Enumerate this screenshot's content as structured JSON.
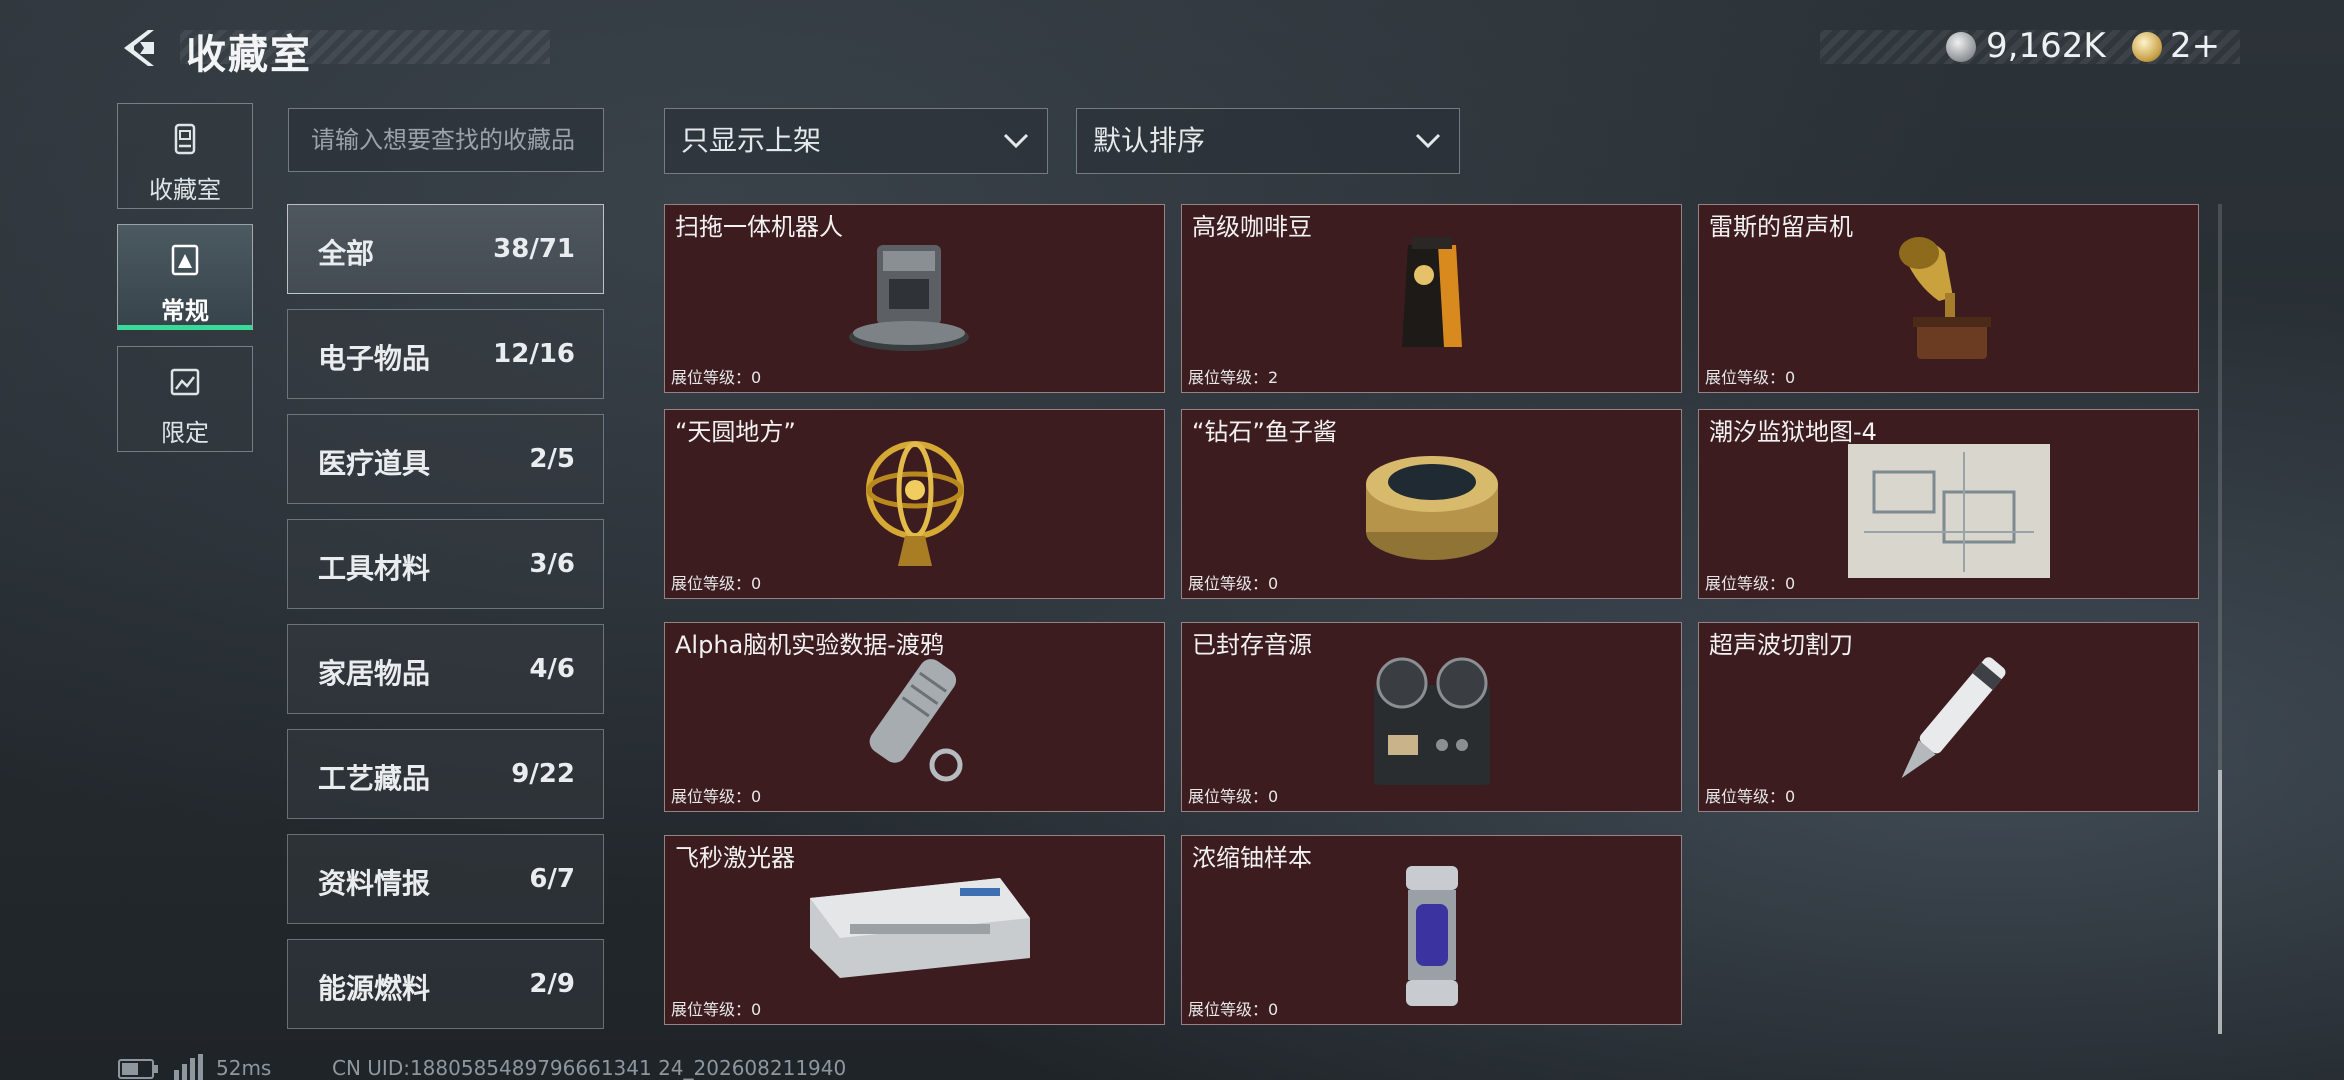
{
  "header": {
    "title": "收藏室",
    "currency": [
      {
        "icon": "silver-coin-icon",
        "value": "9,162K"
      },
      {
        "icon": "gold-coin-icon",
        "value": "2+"
      }
    ]
  },
  "side_tabs": [
    {
      "label": "收藏室",
      "icon": "collection-icon"
    },
    {
      "label": "常规",
      "icon": "regular-icon",
      "active": true
    },
    {
      "label": "限定",
      "icon": "limited-icon"
    }
  ],
  "search": {
    "placeholder": "请输入想要查找的收藏品"
  },
  "filters": {
    "display": "只显示上架",
    "sort": "默认排序"
  },
  "categories": [
    {
      "name": "全部",
      "count": "38/71",
      "active": true
    },
    {
      "name": "电子物品",
      "count": "12/16"
    },
    {
      "name": "医疗道具",
      "count": "2/5"
    },
    {
      "name": "工具材料",
      "count": "3/6"
    },
    {
      "name": "家居物品",
      "count": "4/6"
    },
    {
      "name": "工艺藏品",
      "count": "9/22"
    },
    {
      "name": "资料情报",
      "count": "6/7"
    },
    {
      "name": "能源燃料",
      "count": "2/9"
    }
  ],
  "items": [
    {
      "name": "扫拖一体机器人",
      "level": "展位等级：0",
      "icon": "robot-vacuum-icon"
    },
    {
      "name": "高级咖啡豆",
      "level": "展位等级：2",
      "icon": "coffee-bag-icon"
    },
    {
      "name": "雷斯的留声机",
      "level": "展位等级：0",
      "icon": "gramophone-icon"
    },
    {
      "name": "“天圆地方”",
      "level": "展位等级：0",
      "icon": "armillary-sphere-icon"
    },
    {
      "name": "“钻石”鱼子酱",
      "level": "展位等级：0",
      "icon": "caviar-tin-icon"
    },
    {
      "name": "潮汐监狱地图-4",
      "level": "展位等级：0",
      "icon": "prison-map-icon"
    },
    {
      "name": "Alpha脑机实验数据-渡鸦",
      "level": "展位等级：0",
      "icon": "data-drive-icon"
    },
    {
      "name": "已封存音源",
      "level": "展位等级：0",
      "icon": "reel-recorder-icon"
    },
    {
      "name": "超声波切割刀",
      "level": "展位等级：0",
      "icon": "ultrasonic-cutter-icon"
    },
    {
      "name": "飞秒激光器",
      "level": "展位等级：0",
      "icon": "femtosecond-laser-icon"
    },
    {
      "name": "浓缩铀样本",
      "level": "展位等级：0",
      "icon": "uranium-sample-icon"
    }
  ],
  "footer": {
    "ping": "52ms",
    "uid": "CN UID:1880585489796661341 24_202608211940"
  }
}
